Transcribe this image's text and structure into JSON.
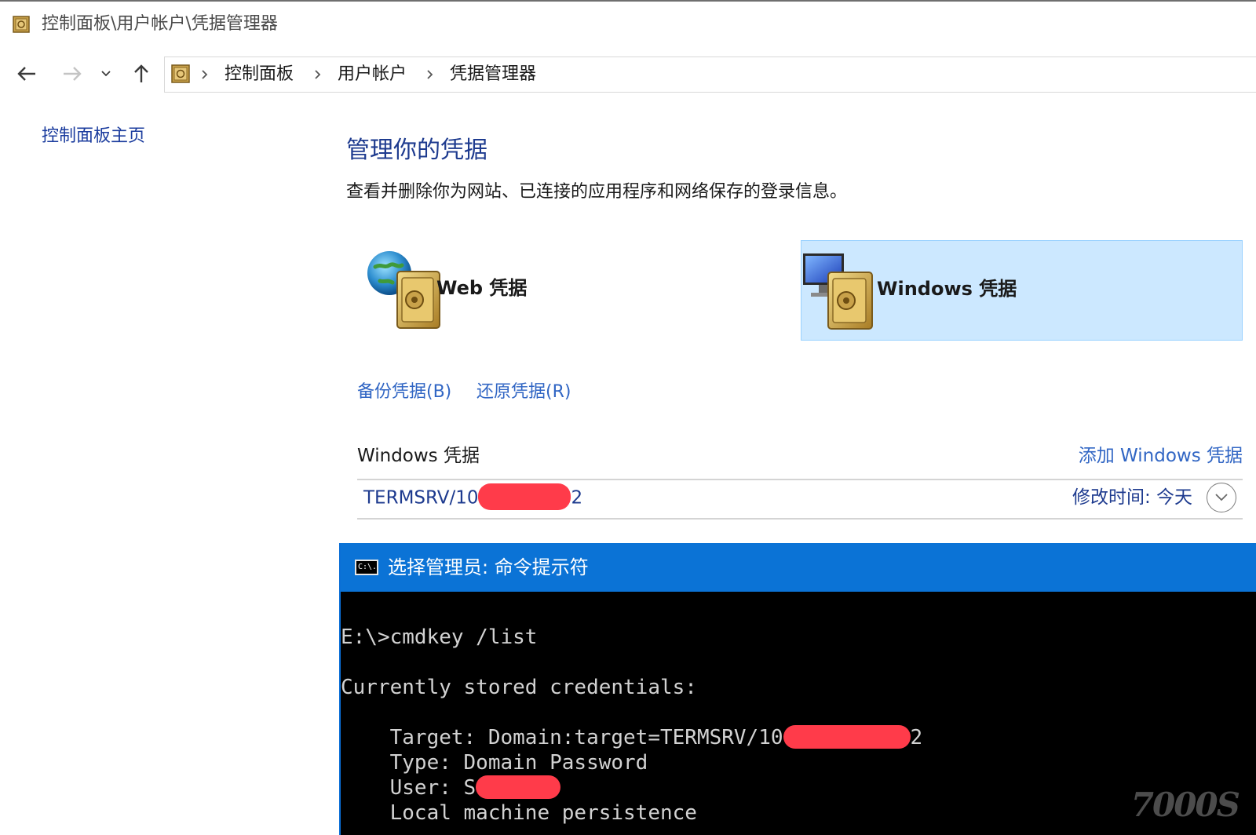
{
  "window": {
    "title": "控制面板\\用户帐户\\凭据管理器"
  },
  "nav": {
    "breadcrumbs": [
      "控制面板",
      "用户帐户",
      "凭据管理器"
    ]
  },
  "sidebar": {
    "home_link": "控制面板主页"
  },
  "main": {
    "title": "管理你的凭据",
    "description": "查看并删除你为网站、已连接的应用程序和网络保存的登录信息。",
    "tiles": {
      "web": "Web 凭据",
      "windows": "Windows 凭据"
    },
    "backup_link": "备份凭据(B)",
    "restore_link": "还原凭据(R)",
    "section": {
      "title": "Windows 凭据",
      "add_link": "添加 Windows 凭据"
    },
    "credential": {
      "name_prefix": "TERMSRV/10",
      "name_suffix": "2",
      "modified": "修改时间: 今天"
    }
  },
  "console": {
    "title": "选择管理员: 命令提示符",
    "icon_text": "C:\\.",
    "lines": {
      "cmd": "E:\\>cmdkey /list",
      "header": "Currently stored credentials:",
      "target_prefix": "    Target: Domain:target=TERMSRV/10",
      "target_suffix": "2",
      "type": "    Type: Domain Password",
      "user_prefix": "    User: S",
      "persistence": "    Local machine persistence"
    }
  },
  "watermark": "7000S",
  "colors": {
    "link": "#3166c4",
    "title_blue": "#1e3b8f",
    "selected_tile": "#cce8ff",
    "console_title_bar": "#0b73d6",
    "redaction": "#ff3b4a"
  }
}
